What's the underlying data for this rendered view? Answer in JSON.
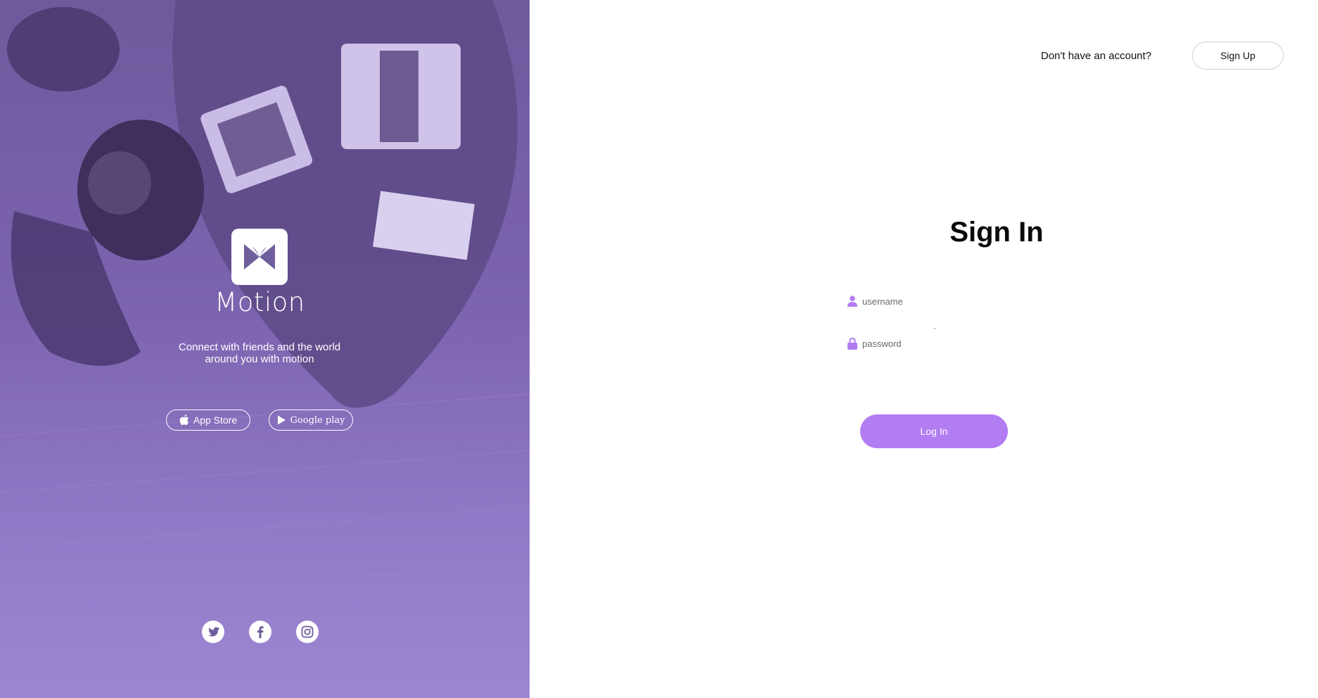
{
  "brand": {
    "name": "Motion",
    "tagline_line1": "Connect with friends and the world",
    "tagline_line2": "around you with motion"
  },
  "stores": {
    "app_store_label": "App Store",
    "google_play_label": "Google play"
  },
  "social": [
    {
      "icon": "twitter-icon"
    },
    {
      "icon": "facebook-icon"
    },
    {
      "icon": "instagram-icon"
    }
  ],
  "header": {
    "no_account_text": "Don't have an account?",
    "signup_label": "Sign Up"
  },
  "form": {
    "title": "Sign In",
    "username_placeholder": "username",
    "password_placeholder": "password",
    "login_label": "Log In"
  },
  "colors": {
    "accent": "#b27cf3",
    "hero_overlay": "#7c64b0"
  }
}
